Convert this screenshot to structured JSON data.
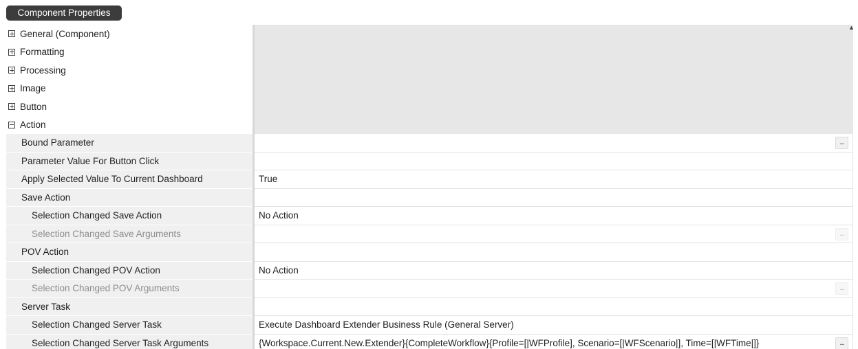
{
  "panel": {
    "title": "Component Properties"
  },
  "icons": {
    "collapsed": "plus-box-icon",
    "expanded": "minus-box-icon",
    "ellipsis": "ellipsis-icon",
    "scroll_up": "scroll-up-arrow-icon"
  },
  "categories": {
    "general": "General (Component)",
    "formatting": "Formatting",
    "processing": "Processing",
    "image": "Image",
    "button": "Button",
    "action": "Action"
  },
  "action": {
    "bound_parameter": {
      "label": "Bound Parameter",
      "value": "",
      "button": "..."
    },
    "parameter_value": {
      "label": "Parameter Value For Button Click",
      "value": ""
    },
    "apply_selected": {
      "label": "Apply Selected Value To Current Dashboard",
      "value": "True"
    },
    "save_action": {
      "label": "Save Action",
      "changed_action": {
        "label": "Selection Changed Save Action",
        "value": "No Action"
      },
      "changed_arguments": {
        "label": "Selection Changed Save Arguments",
        "value": "",
        "button": "..."
      }
    },
    "pov_action": {
      "label": "POV Action",
      "changed_action": {
        "label": "Selection Changed POV Action",
        "value": "No Action"
      },
      "changed_arguments": {
        "label": "Selection Changed POV Arguments",
        "value": "",
        "button": "..."
      }
    },
    "server_task": {
      "label": "Server Task",
      "changed_task": {
        "label": "Selection Changed Server Task",
        "value": "Execute Dashboard Extender Business Rule (General Server)"
      },
      "changed_arguments": {
        "label": "Selection Changed Server Task Arguments",
        "value": "{Workspace.Current.New.Extender}{CompleteWorkflow}{Profile=[|WFProfile], Scenario=[|WFScenario|], Time=[|WFTime|]}",
        "button": "..."
      }
    }
  },
  "colors": {
    "tab_bg": "#3c3c3c",
    "category_bg": "#e7e7e7",
    "property_name_bg": "#f0f0f0",
    "disabled_text": "#8c8c8c"
  }
}
